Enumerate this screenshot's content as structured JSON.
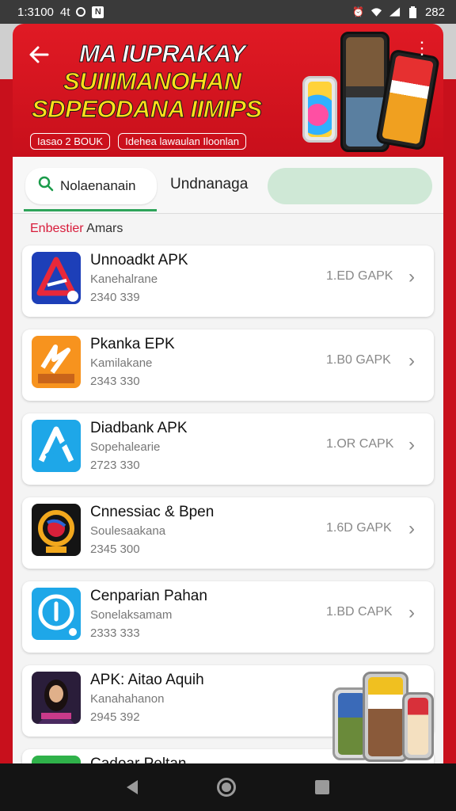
{
  "status_bar": {
    "time": "1:3100",
    "carrier_glyph": "4t",
    "battery": "282",
    "icons": [
      "signal-circle-icon",
      "notification-box-icon",
      "alarm-icon",
      "wifi-icon",
      "signal-bars-icon",
      "battery-icon"
    ]
  },
  "banner": {
    "title_line1": "MA IUPRAKAY",
    "title_line2": "SUIIIMANOHAN",
    "title_line3": "SDPEODANA IIMIPS",
    "tag1": "Iasao 2 BOUK",
    "tag2": "Idehea lawaulan Iloonlan",
    "colors": {
      "background": "#d8121e",
      "title_accent": "#ffe11a"
    }
  },
  "tabs": {
    "search_tab_label": "Nolaenanain",
    "second_tab_label": "Undnanaga",
    "accent_color": "#2ea45a"
  },
  "section": {
    "label_accent": "Enbestier",
    "label_rest": " Amars"
  },
  "apps": [
    {
      "name": "Unnoadkt APK",
      "developer": "Kanehalrane",
      "downloads": "2340 339",
      "size": "1.ED GAPK",
      "icon": "red-triangle-logo-icon"
    },
    {
      "name": "Pkanka EPK",
      "developer": "Kamilakane",
      "downloads": "2343 330",
      "size": "1.B0 GAPK",
      "icon": "orange-ape-logo-icon"
    },
    {
      "name": "Diadbank APK",
      "developer": "Sopehalearie",
      "downloads": "2723 330",
      "size": "1.OR CAPK",
      "icon": "blue-a-logo-icon"
    },
    {
      "name": "Cnnessiac & Bpen",
      "developer": "Soulesaakana",
      "downloads": "2345 300",
      "size": "1.6D GAPK",
      "icon": "dark-lens-logo-icon"
    },
    {
      "name": "Cenparian Pahan",
      "developer": "Sonelaksamam",
      "downloads": "2333 333",
      "size": "1.BD CAPK",
      "icon": "blue-power-logo-icon"
    },
    {
      "name": "APK: Aitao Aquih",
      "developer": "Kanahahanon",
      "downloads": "2945 392",
      "size": "",
      "icon": "portrait-app-icon"
    },
    {
      "name": "Cadoar Peltan",
      "developer": "",
      "downloads": "",
      "size": "",
      "icon": "green-orange-logo-icon"
    }
  ]
}
